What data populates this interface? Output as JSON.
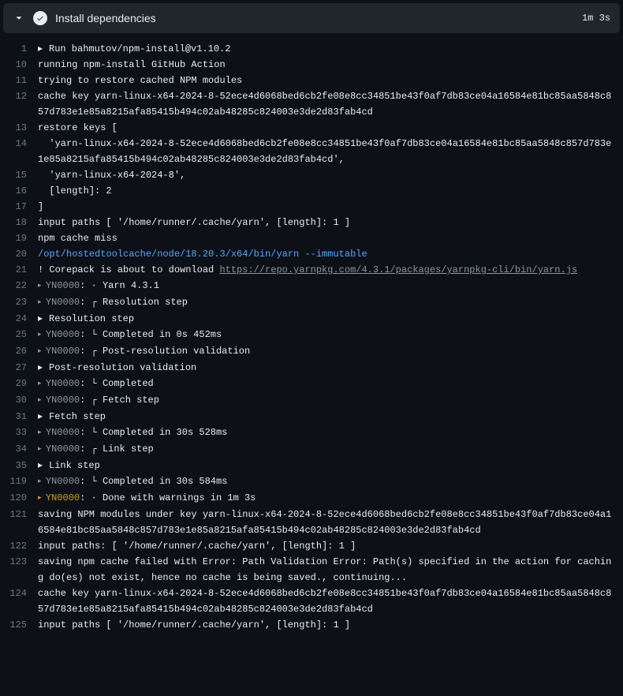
{
  "header": {
    "title": "Install dependencies",
    "elapsed": "1m 3s"
  },
  "lines": [
    {
      "num": "1",
      "segs": [
        {
          "cls": "expand-marker",
          "txt": "▸ "
        },
        {
          "txt": "Run bahmutov/npm-install@v1.10.2"
        }
      ]
    },
    {
      "num": "10",
      "segs": [
        {
          "txt": "running npm-install GitHub Action"
        }
      ]
    },
    {
      "num": "11",
      "segs": [
        {
          "txt": "trying to restore cached NPM modules"
        }
      ]
    },
    {
      "num": "12",
      "segs": [
        {
          "txt": "cache key yarn-linux-x64-2024-8-52ece4d6068bed6cb2fe08e8cc34851be43f0af7db83ce04a16584e81bc85aa5848c857d783e1e85a8215afa85415b494c02ab48285c824003e3de2d83fab4cd"
        }
      ]
    },
    {
      "num": "13",
      "segs": [
        {
          "txt": "restore keys ["
        }
      ]
    },
    {
      "num": "14",
      "segs": [
        {
          "txt": "  'yarn-linux-x64-2024-8-52ece4d6068bed6cb2fe08e8cc34851be43f0af7db83ce04a16584e81bc85aa5848c857d783e1e85a8215afa85415b494c02ab48285c824003e3de2d83fab4cd',"
        }
      ]
    },
    {
      "num": "15",
      "segs": [
        {
          "txt": "  'yarn-linux-x64-2024-8',"
        }
      ]
    },
    {
      "num": "16",
      "segs": [
        {
          "txt": "  [length]: 2"
        }
      ]
    },
    {
      "num": "17",
      "segs": [
        {
          "txt": "]"
        }
      ]
    },
    {
      "num": "18",
      "segs": [
        {
          "txt": "input paths [ '/home/runner/.cache/yarn', [length]: 1 ]"
        }
      ]
    },
    {
      "num": "19",
      "segs": [
        {
          "txt": "npm cache miss"
        }
      ]
    },
    {
      "num": "20",
      "segs": [
        {
          "cls": "blue-cmd",
          "txt": "/opt/hostedtoolcache/node/18.20.3/x64/bin/yarn --immutable"
        }
      ]
    },
    {
      "num": "21",
      "segs": [
        {
          "txt": "! Corepack is about to download "
        },
        {
          "cls": "link",
          "txt": "https://repo.yarnpkg.com/4.3.1/packages/yarnpkg-cli/bin/yarn.js"
        }
      ]
    },
    {
      "num": "22",
      "segs": [
        {
          "cls": "dim tri",
          "txt": "▸ "
        },
        {
          "cls": "dim",
          "txt": "YN0000"
        },
        {
          "txt": ": · Yarn 4.3.1"
        }
      ]
    },
    {
      "num": "23",
      "segs": [
        {
          "cls": "dim tri",
          "txt": "▸ "
        },
        {
          "cls": "dim",
          "txt": "YN0000"
        },
        {
          "txt": ": ┌ Resolution step"
        }
      ]
    },
    {
      "num": "24",
      "segs": [
        {
          "cls": "expand-marker",
          "txt": "▸ "
        },
        {
          "txt": "Resolution step"
        }
      ]
    },
    {
      "num": "25",
      "segs": [
        {
          "cls": "dim tri",
          "txt": "▸ "
        },
        {
          "cls": "dim",
          "txt": "YN0000"
        },
        {
          "txt": ": └ Completed in 0s 452ms"
        }
      ]
    },
    {
      "num": "26",
      "segs": [
        {
          "cls": "dim tri",
          "txt": "▸ "
        },
        {
          "cls": "dim",
          "txt": "YN0000"
        },
        {
          "txt": ": ┌ Post-resolution validation"
        }
      ]
    },
    {
      "num": "27",
      "segs": [
        {
          "cls": "expand-marker",
          "txt": "▸ "
        },
        {
          "txt": "Post-resolution validation"
        }
      ]
    },
    {
      "num": "29",
      "segs": [
        {
          "cls": "dim tri",
          "txt": "▸ "
        },
        {
          "cls": "dim",
          "txt": "YN0000"
        },
        {
          "txt": ": └ Completed"
        }
      ]
    },
    {
      "num": "30",
      "segs": [
        {
          "cls": "dim tri",
          "txt": "▸ "
        },
        {
          "cls": "dim",
          "txt": "YN0000"
        },
        {
          "txt": ": ┌ Fetch step"
        }
      ]
    },
    {
      "num": "31",
      "segs": [
        {
          "cls": "expand-marker",
          "txt": "▸ "
        },
        {
          "txt": "Fetch step"
        }
      ]
    },
    {
      "num": "33",
      "segs": [
        {
          "cls": "dim tri",
          "txt": "▸ "
        },
        {
          "cls": "dim",
          "txt": "YN0000"
        },
        {
          "txt": ": └ Completed in 30s 528ms"
        }
      ]
    },
    {
      "num": "34",
      "segs": [
        {
          "cls": "dim tri",
          "txt": "▸ "
        },
        {
          "cls": "dim",
          "txt": "YN0000"
        },
        {
          "txt": ": ┌ Link step"
        }
      ]
    },
    {
      "num": "35",
      "segs": [
        {
          "cls": "expand-marker",
          "txt": "▸ "
        },
        {
          "txt": "Link step"
        }
      ]
    },
    {
      "num": "119",
      "segs": [
        {
          "cls": "dim tri",
          "txt": "▸ "
        },
        {
          "cls": "dim",
          "txt": "YN0000"
        },
        {
          "txt": ": └ Completed in 30s 584ms"
        }
      ]
    },
    {
      "num": "120",
      "segs": [
        {
          "cls": "yellow-marker tri",
          "txt": "▸ "
        },
        {
          "cls": "yellow-marker",
          "txt": "YN0000"
        },
        {
          "txt": ": · Done with warnings in 1m 3s"
        }
      ]
    },
    {
      "num": "121",
      "segs": [
        {
          "txt": "saving NPM modules under key yarn-linux-x64-2024-8-52ece4d6068bed6cb2fe08e8cc34851be43f0af7db83ce04a16584e81bc85aa5848c857d783e1e85a8215afa85415b494c02ab48285c824003e3de2d83fab4cd"
        }
      ]
    },
    {
      "num": "122",
      "segs": [
        {
          "txt": "input paths: [ '/home/runner/.cache/yarn', [length]: 1 ]"
        }
      ]
    },
    {
      "num": "123",
      "segs": [
        {
          "txt": "saving npm cache failed with Error: Path Validation Error: Path(s) specified in the action for caching do(es) not exist, hence no cache is being saved., continuing..."
        }
      ]
    },
    {
      "num": "124",
      "segs": [
        {
          "txt": "cache key yarn-linux-x64-2024-8-52ece4d6068bed6cb2fe08e8cc34851be43f0af7db83ce04a16584e81bc85aa5848c857d783e1e85a8215afa85415b494c02ab48285c824003e3de2d83fab4cd"
        }
      ]
    },
    {
      "num": "125",
      "segs": [
        {
          "txt": "input paths [ '/home/runner/.cache/yarn', [length]: 1 ]"
        }
      ]
    }
  ]
}
